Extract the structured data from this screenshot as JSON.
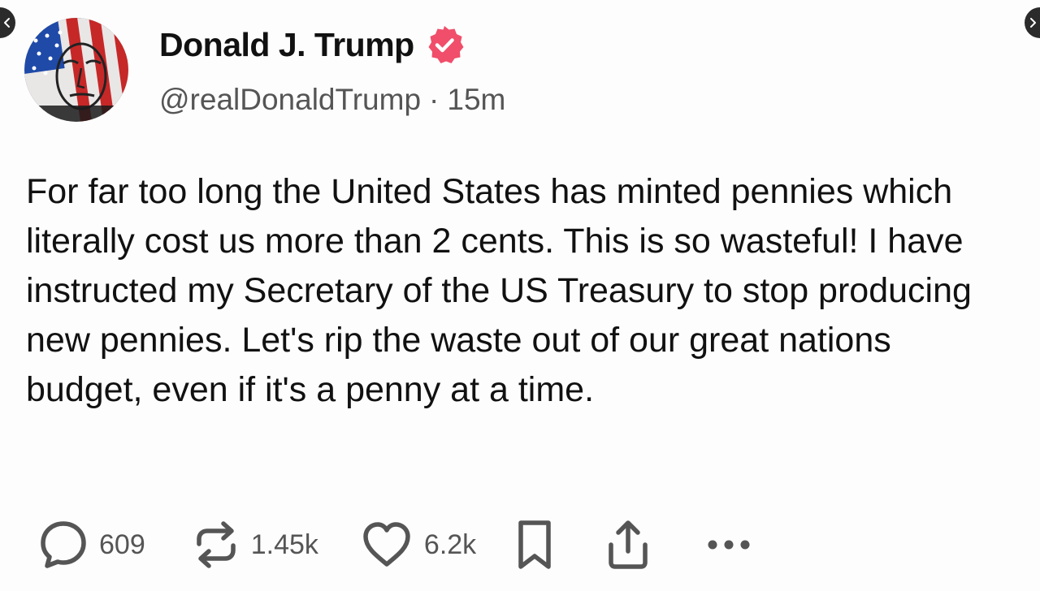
{
  "post": {
    "author_name": "Donald J. Trump",
    "handle": "@realDonaldTrump",
    "separator": "·",
    "time_ago": "15m",
    "verified": true,
    "text": "For far too long the United States has minted pennies which literally cost us more than 2 cents. This is so wasteful! I have instructed my Secretary of the US Treasury to stop producing new pennies. Let's rip the waste out of our great nations budget, even if it's a penny at a time."
  },
  "actions": {
    "replies": "609",
    "reposts": "1.45k",
    "likes": "6.2k"
  },
  "icons": {
    "nav_prev": "chevron-left-icon",
    "nav_next": "chevron-right-icon",
    "verified": "verified-badge-icon",
    "reply": "reply-bubble-icon",
    "repost": "repost-icon",
    "like": "heart-icon",
    "bookmark": "bookmark-icon",
    "share": "share-icon",
    "more": "more-dots-icon"
  },
  "colors": {
    "verified_badge": "#f04e6a",
    "text_primary": "#111111",
    "text_secondary": "#555555",
    "background": "#fdfdfd"
  }
}
